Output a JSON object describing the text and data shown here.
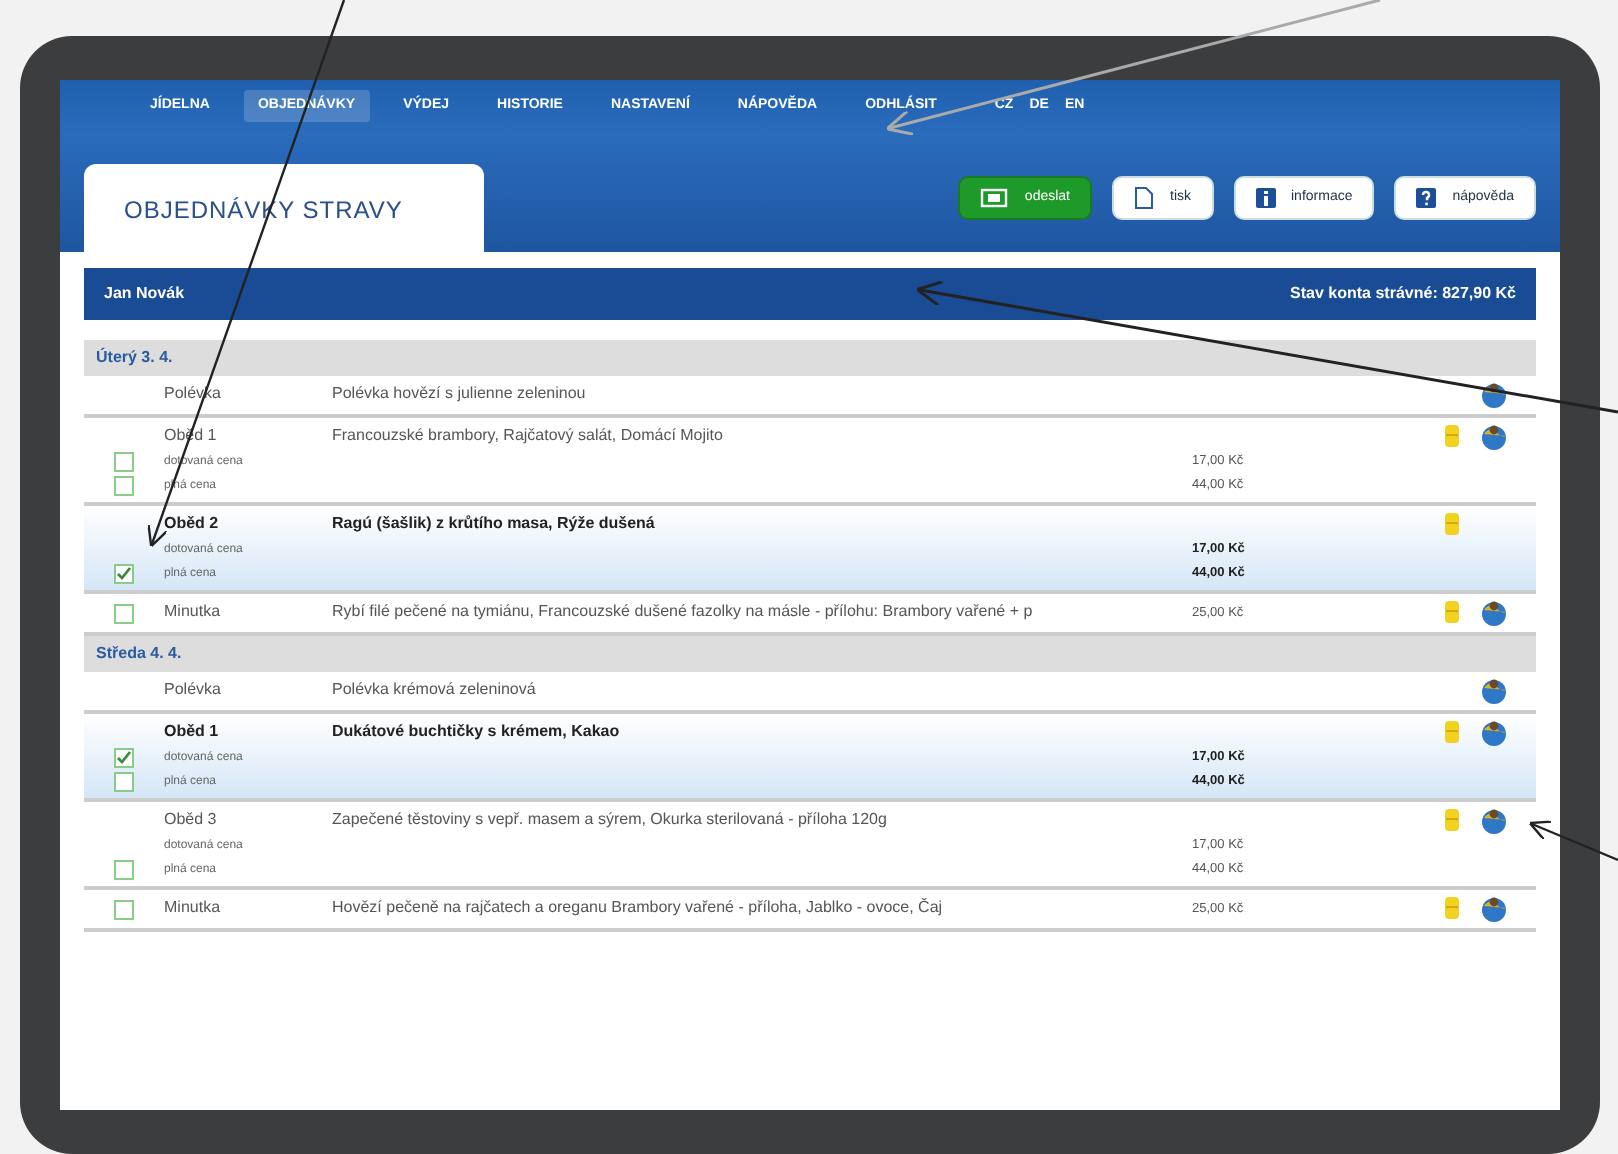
{
  "nav": [
    {
      "label": "JÍDELNA",
      "selected": false
    },
    {
      "label": "OBJEDNÁVKY",
      "selected": true
    },
    {
      "label": "VÝDEJ",
      "selected": false
    },
    {
      "label": "HISTORIE",
      "selected": false
    },
    {
      "label": "NASTAVENÍ",
      "selected": false
    },
    {
      "label": "NÁPOVĚDA",
      "selected": false
    },
    {
      "label": "ODHLÁSIT",
      "selected": false
    }
  ],
  "languages": [
    "CZ",
    "DE",
    "EN"
  ],
  "title": "OBJEDNÁVKY STRAVY",
  "buttons": [
    {
      "label": "odeslat",
      "kind": "send"
    },
    {
      "label": "tisk",
      "kind": "print"
    },
    {
      "label": "informace",
      "kind": "info"
    },
    {
      "label": "nápověda",
      "kind": "help"
    }
  ],
  "account": {
    "name": "Jan Novák",
    "balance": "Stav konta strávné: 827,90 Kč"
  },
  "days": [
    {
      "label": "Úterý 3. 4.",
      "meals": [
        {
          "course": "Polévka",
          "description": "Polévka hovězí s julienne zeleninou",
          "selected": false,
          "note": false,
          "globe": true
        },
        {
          "course": "Oběd 1",
          "description": "Francouzské brambory, Rajčatový salát, Domácí Mojito",
          "selected": false,
          "note": true,
          "globe": true,
          "options": [
            {
              "label": "dotovaná cena",
              "price": "17,00 Kč",
              "checked": false
            },
            {
              "label": "plná cena",
              "price": "44,00 Kč",
              "checked": false
            }
          ]
        },
        {
          "course": "Oběd 2",
          "description": "Ragú (šašlik) z krůtího masa, Rýže dušená",
          "selected": true,
          "note": true,
          "globe": false,
          "options": [
            {
              "label": "dotovaná cena",
              "price": "17,00 Kč"
            },
            {
              "label": "plná cena",
              "price": "44,00 Kč",
              "checked": true
            }
          ]
        },
        {
          "course": "Minutka",
          "description": "Rybí filé pečené na tymiánu, Francouzské dušené fazolky na másle - přílohu: Brambory vařené + p",
          "selected": false,
          "note": true,
          "globe": true,
          "options": [
            {
              "price": "25,00 Kč",
              "checked": false
            }
          ]
        }
      ]
    },
    {
      "label": "Středa 4. 4.",
      "meals": [
        {
          "course": "Polévka",
          "description": "Polévka krémová zeleninová",
          "selected": false,
          "note": false,
          "globe": true
        },
        {
          "course": "Oběd 1",
          "description": "Dukátové buchtičky s krémem, Kakao",
          "selected": true,
          "note": true,
          "globe": true,
          "options": [
            {
              "label": "dotovaná cena",
              "price": "17,00 Kč",
              "checked": true
            },
            {
              "label": "plná cena",
              "price": "44,00 Kč",
              "checked": false
            }
          ]
        },
        {
          "course": "Oběd 3",
          "description": "Zapečené těstoviny s vepř. masem a sýrem, Okurka sterilovaná - příloha 120g",
          "selected": false,
          "note": true,
          "globe": true,
          "options": [
            {
              "label": "dotovaná cena",
              "price": "17,00 Kč"
            },
            {
              "label": "plná cena",
              "price": "44,00 Kč",
              "checked": false
            }
          ]
        },
        {
          "course": "Minutka",
          "description": "Hovězí pečeně na rajčatech a oreganu Brambory vařené - příloha, Jablko - ovoce, Čaj",
          "selected": false,
          "note": true,
          "globe": true,
          "options": [
            {
              "price": "25,00 Kč",
              "checked": false
            }
          ]
        }
      ]
    }
  ]
}
